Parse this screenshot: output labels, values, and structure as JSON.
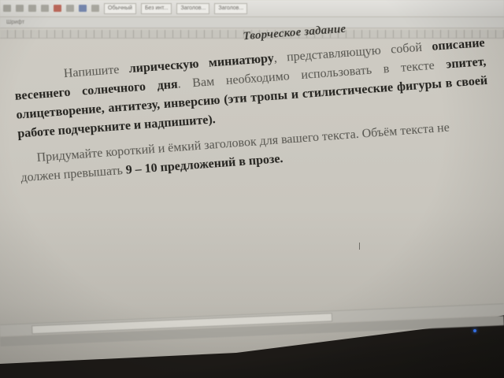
{
  "toolbar": {
    "style_boxes": [
      "Обычный",
      "Без инт...",
      "Заголов...",
      "Заголов..."
    ],
    "group_label": "Шрифт"
  },
  "document": {
    "title": "Творческое задание",
    "p1": {
      "w1": "Напишите",
      "w2": "лирическую миниатюру",
      "w3": ", представляющую собой",
      "w4": "описание весеннего солнечного дня",
      "w5": ". Вам необходимо использовать в тексте",
      "w6": "эпитет, олицетворение, антитезу, инверсию",
      "w7": " (эти тропы и стилистические",
      "w8": "фигуры в своей работе подчеркните и надпишите)."
    },
    "p2": {
      "w1": "Придумайте короткий и ёмкий заголовок для вашего текста. Объём текста не должен превышать ",
      "w2": "9 – 10 предложений в прозе",
      "w3": "."
    }
  },
  "colors": {
    "power_led": "#3b7dff"
  }
}
